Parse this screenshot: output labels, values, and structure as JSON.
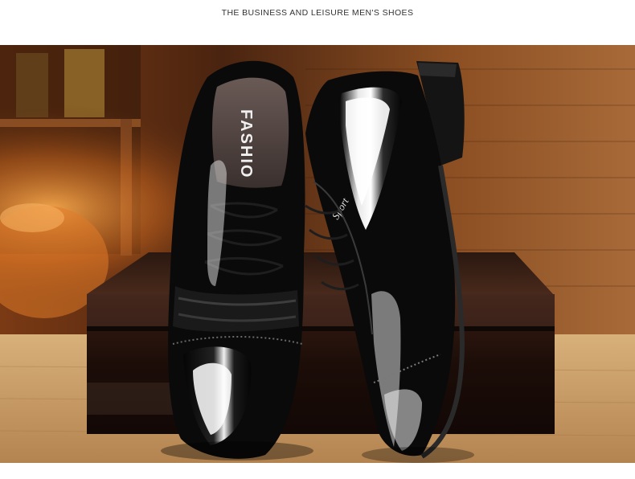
{
  "header": {
    "title": "THE BUSINESS AND LEISURE MEN'S SHOES"
  },
  "photo": {
    "subject": "black patent leather lace-up oxford shoes",
    "insole_print": "FASHIO",
    "side_logo": "Sport",
    "colors": {
      "wood_wall_light": "#9a5a2a",
      "wood_wall_dark": "#4a2410",
      "table_top": "#c89a60",
      "box_dark": "#1a0c08",
      "leather": "#0b0b0b",
      "highlight": "#f4f4f4"
    }
  }
}
